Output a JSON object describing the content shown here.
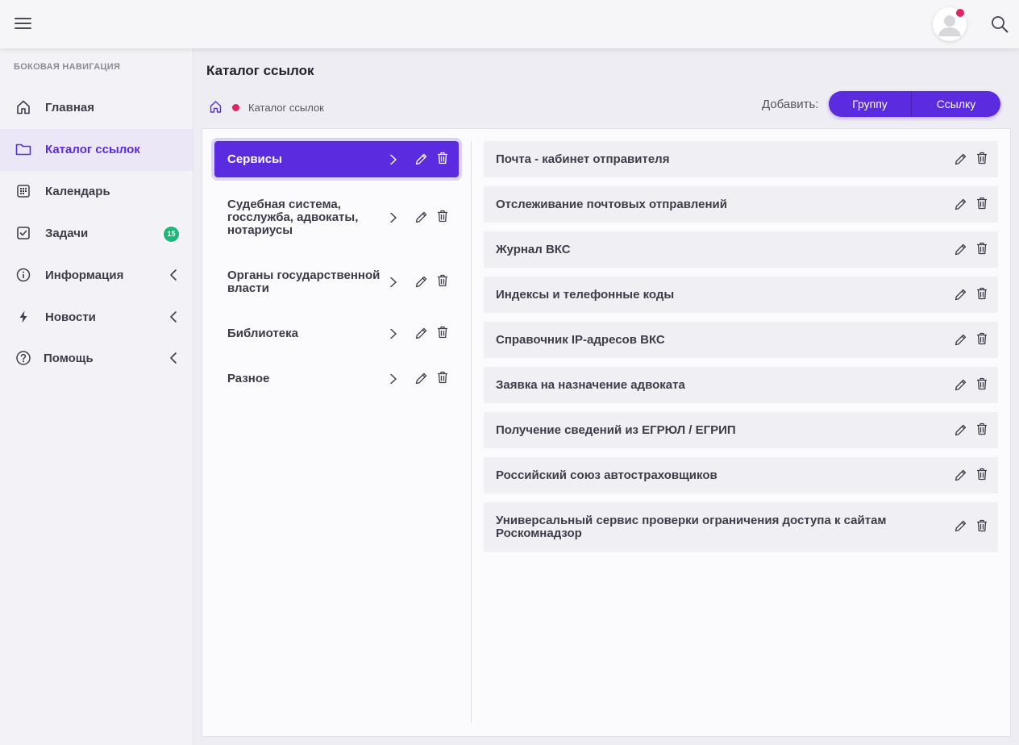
{
  "header": {
    "menu_icon": "hamburger-icon",
    "avatar_icon": "user-avatar-icon",
    "search_icon": "search-icon"
  },
  "sidebar": {
    "title": "БОКОВАЯ НАВИГАЦИЯ",
    "items": [
      {
        "label": "Главная",
        "icon": "home-icon"
      },
      {
        "label": "Каталог ссылок",
        "icon": "folder-icon",
        "active": true
      },
      {
        "label": "Календарь",
        "icon": "calendar-icon"
      },
      {
        "label": "Задачи",
        "icon": "checkbox-icon",
        "badge": "15"
      },
      {
        "label": "Информация",
        "icon": "info-icon",
        "expandable": true
      },
      {
        "label": "Новости",
        "icon": "lightning-icon",
        "expandable": true
      },
      {
        "label": "Помощь",
        "icon": "help-icon",
        "expandable": true
      }
    ]
  },
  "main": {
    "title": "Каталог ссылок",
    "breadcrumb": {
      "current": "Каталог ссылок"
    },
    "add": {
      "label": "Добавить:",
      "group_button": "Группу",
      "link_button": "Ссылку"
    },
    "groups": [
      {
        "label": "Сервисы",
        "active": true
      },
      {
        "label": "Судебная система, госслужба, адвокаты, нотариусы"
      },
      {
        "label": "Органы государственной власти"
      },
      {
        "label": "Библиотека"
      },
      {
        "label": "Разное"
      }
    ],
    "links": [
      {
        "label": "Почта - кабинет отправителя"
      },
      {
        "label": "Отслеживание почтовых отправлений"
      },
      {
        "label": "Журнал ВКС"
      },
      {
        "label": "Индексы и телефонные коды"
      },
      {
        "label": "Справочник IP-адресов ВКС"
      },
      {
        "label": "Заявка на назначение адвоката"
      },
      {
        "label": "Получение сведений из ЕГРЮЛ / ЕГРИП"
      },
      {
        "label": "Российский союз автостраховщиков"
      },
      {
        "label": "Универсальный сервис проверки ограничения доступа к сайтам Роскомнадзор"
      }
    ]
  },
  "colors": {
    "accent": "#5b2be0",
    "badge": "#1bb877",
    "notification": "#e0245e"
  }
}
